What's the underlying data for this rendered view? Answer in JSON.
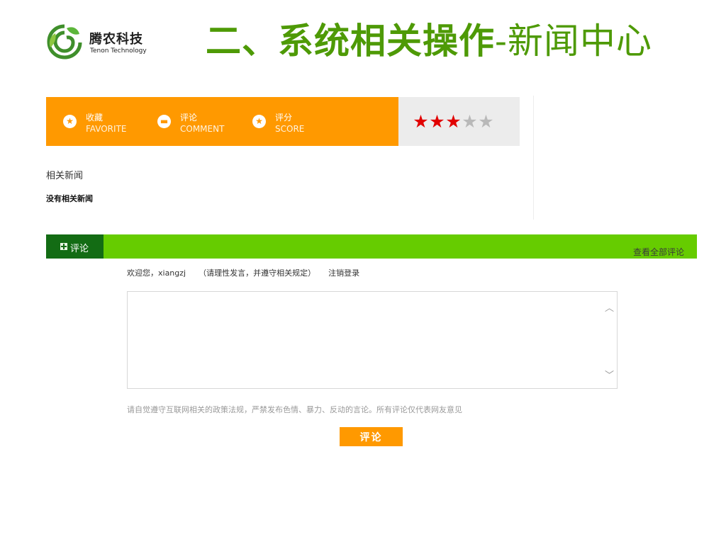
{
  "header": {
    "logo_cn": "腾农科技",
    "logo_en": "Tenon Technology",
    "title_bold": "二、系统相关操作",
    "title_rest": "-新闻中心"
  },
  "actions": [
    {
      "cn": "收藏",
      "en": "FAVORITE",
      "icon": "star-circle-icon"
    },
    {
      "cn": "评论",
      "en": "COMMENT",
      "icon": "speech-bubble-icon"
    },
    {
      "cn": "评分",
      "en": "SCORE",
      "icon": "star-circle-icon"
    }
  ],
  "rating": {
    "value": 3,
    "max": 5
  },
  "related": {
    "heading": "相关新闻",
    "empty_text": "没有相关新闻"
  },
  "comments": {
    "tab_label": "评论",
    "view_all": "查看全部评论",
    "welcome": "欢迎您，xiangzj",
    "rule_hint": "（请理性发言，并遵守相关规定）",
    "logout": "注销登录",
    "notice": "请自觉遵守互联网相关的政策法规，严禁发布色情、暴力、反动的言论。所有评论仅代表网友意见",
    "submit_label": "评论",
    "textarea_value": ""
  },
  "colors": {
    "orange": "#ff9900",
    "green_bar": "#66cc00",
    "green_dark": "#136c14",
    "title_green": "#4e9a06",
    "star_on": "#e10000",
    "star_off": "#b9b9b9"
  }
}
